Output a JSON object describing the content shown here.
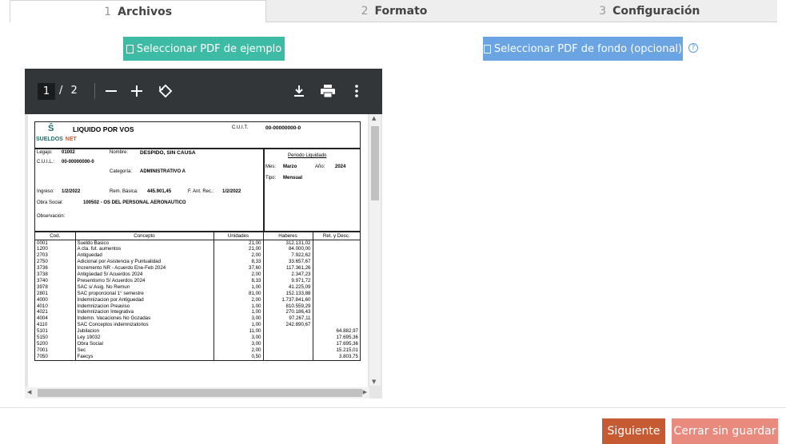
{
  "tabs": [
    {
      "num": "1",
      "label": "Archivos"
    },
    {
      "num": "2",
      "label": "Formato"
    },
    {
      "num": "3",
      "label": "Configuración"
    }
  ],
  "buttons": {
    "select_example": "Seleccionar PDF de ejemplo",
    "select_background": "Seleccionar PDF de fondo (opcional)",
    "help": "?",
    "next": "Siguiente",
    "close": "Cerrar sin guardar"
  },
  "viewer": {
    "page_current": "1",
    "page_sep": "/",
    "page_total": "2"
  },
  "doc": {
    "logo_top": "Ŝ",
    "logo_text_a": "SUELDOS",
    "logo_text_b": "NET",
    "title": "LIQUIDO POR VOS",
    "cuit_label": "C.U.I.T.",
    "cuit_value": "00-00000000-0",
    "legajo_label": "Legajo:",
    "legajo_value": "01002",
    "nombre_label": "Nombre:",
    "nombre_value": "DESPIDO, SIN CAUSA",
    "cuil_label": "C.U.I.L.:",
    "cuil_value": "00-00000000-0",
    "categoria_label": "Categoría:",
    "categoria_value": "ADMINISTRATIVO A",
    "ingreso_label": "Ingreso:",
    "ingreso_value": "1/2/2022",
    "rem_label": "Rem. Básica:",
    "rem_value": "445.901,45",
    "fant_label": "F. Ant. Rec.:",
    "fant_value": "1/2/2022",
    "obra_label": "Obra Social:",
    "obra_value": "100502 - OS  DEL PERSONAL AERONAUTICO",
    "obs_label": "Observación:",
    "periodo_label": "Periodo Liquidado",
    "mes_label": "Mes:",
    "mes_value": "Marzo",
    "anio_label": "Año:",
    "anio_value": "2024",
    "tipo_label": "Tipo:",
    "tipo_value": "Mensual",
    "columns": [
      "Cod.",
      "Concepto",
      "Unidades",
      "Haberes",
      "Ret. y Desc."
    ],
    "rows": [
      [
        "0001",
        "Sueldo Basico",
        "21,00",
        "312.131,02",
        ""
      ],
      [
        "1200",
        "A cta. fut. aumentos",
        "21,00",
        "84.000,00",
        ""
      ],
      [
        "2703",
        "Antiguedad",
        "2,00",
        "7.922,62",
        ""
      ],
      [
        "2750",
        "Adicional por Asistencia y Puntualidad",
        "8,33",
        "33.657,67",
        ""
      ],
      [
        "3736",
        "Incremento NR - Acuerdo Ene-Feb 2024",
        "37,60",
        "117.361,26",
        ""
      ],
      [
        "3738",
        "Antigüedad S/ Acuerdos 2024",
        "2,00",
        "2.347,23",
        ""
      ],
      [
        "3740",
        "Presentismo S/ Acuerdos 2024",
        "8,33",
        "9.971,72",
        ""
      ],
      [
        "3978",
        "SAC s/ Asig. No Remun",
        "1,00",
        "41.225,09",
        ""
      ],
      [
        "2801",
        "SAC proporcional 1° semestre",
        "81,00",
        "152.133,88",
        ""
      ],
      [
        "4000",
        "Indemnizacion por Antiguedad",
        "2,00",
        "1.737.841,60",
        ""
      ],
      [
        "4010",
        "Indemnizacion Preaviso",
        "1,00",
        "810.559,29",
        ""
      ],
      [
        "4021",
        "Indemnizacion Integrativa",
        "1,00",
        "270.186,43",
        ""
      ],
      [
        "4004",
        "Indemn. Vacaciones No Gozadas",
        "3,00",
        "97.267,11",
        ""
      ],
      [
        "4110",
        "SAC Conceptos indemnizatorios",
        "1,00",
        "242.890,67",
        ""
      ],
      [
        "5101",
        "Jubilacion",
        "11,00",
        "",
        "64.882,97"
      ],
      [
        "5150",
        "Ley 19032",
        "3,00",
        "",
        "17.695,36"
      ],
      [
        "5200",
        "Obra Social",
        "3,00",
        "",
        "17.695,36"
      ],
      [
        "7001",
        "Sec",
        "2,00",
        "",
        "15.215,01"
      ],
      [
        "7050",
        "Faecys",
        "0,50",
        "",
        "3.803,75"
      ]
    ]
  }
}
